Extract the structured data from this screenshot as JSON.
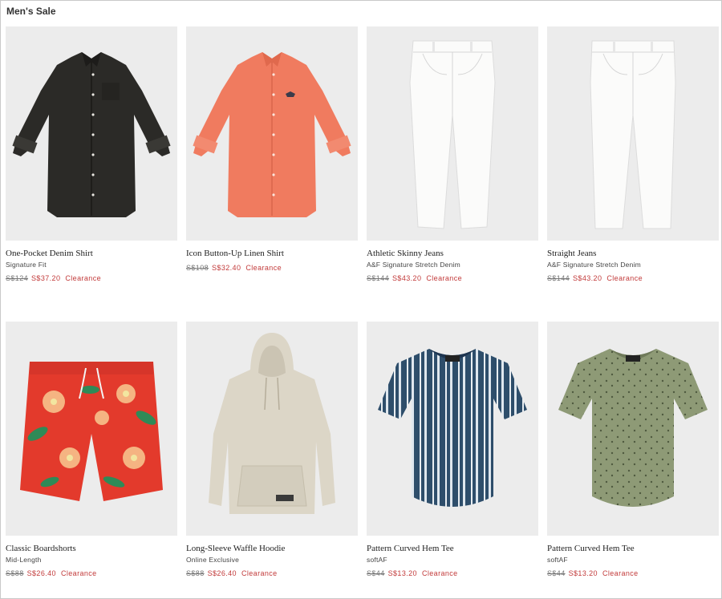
{
  "page": {
    "title": "Men's Sale"
  },
  "colors": {
    "sale": "#c23a3a",
    "original": "#777777"
  },
  "products": [
    {
      "name": "One-Pocket Denim Shirt",
      "subtitle": "Signature Fit",
      "original_price": "S$124",
      "sale_price": "S$37.20",
      "badge": "Clearance",
      "image_icon": "dark-shirt-image"
    },
    {
      "name": "Icon Button-Up Linen Shirt",
      "subtitle": "",
      "original_price": "S$108",
      "sale_price": "S$32.40",
      "badge": "Clearance",
      "image_icon": "coral-shirt-image"
    },
    {
      "name": "Athletic Skinny Jeans",
      "subtitle": "A&F Signature Stretch Denim",
      "original_price": "S$144",
      "sale_price": "S$43.20",
      "badge": "Clearance",
      "image_icon": "white-jeans-image"
    },
    {
      "name": "Straight Jeans",
      "subtitle": "A&F Signature Stretch Denim",
      "original_price": "S$144",
      "sale_price": "S$43.20",
      "badge": "Clearance",
      "image_icon": "white-jeans-image"
    },
    {
      "name": "Classic Boardshorts",
      "subtitle": "Mid-Length",
      "original_price": "S$88",
      "sale_price": "S$26.40",
      "badge": "Clearance",
      "image_icon": "floral-shorts-image"
    },
    {
      "name": "Long-Sleeve Waffle Hoodie",
      "subtitle": "Online Exclusive",
      "original_price": "S$88",
      "sale_price": "S$26.40",
      "badge": "Clearance",
      "image_icon": "hoodie-image"
    },
    {
      "name": "Pattern Curved Hem Tee",
      "subtitle": "softAF",
      "original_price": "S$44",
      "sale_price": "S$13.20",
      "badge": "Clearance",
      "image_icon": "striped-tee-image"
    },
    {
      "name": "Pattern Curved Hem Tee",
      "subtitle": "softAF",
      "original_price": "S$44",
      "sale_price": "S$13.20",
      "badge": "Clearance",
      "image_icon": "olive-tee-image"
    }
  ]
}
